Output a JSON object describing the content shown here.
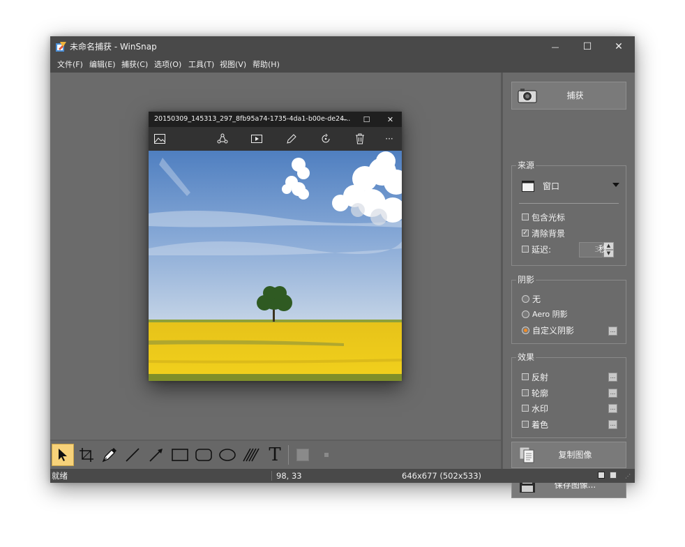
{
  "window": {
    "title": "未命名捕获 - WinSnap",
    "controls": {
      "minimize": "—",
      "maximize": "☐",
      "close": "✕"
    }
  },
  "menu": [
    "文件(F)",
    "编辑(E)",
    "捕获(C)",
    "选项(O)",
    "工具(T)",
    "视图(V)",
    "帮助(H)"
  ],
  "photos_window": {
    "title": "20150309_145313_297_8fb95a74-1735-4da1-b00e-de24...",
    "toolbar_icons": [
      "image-icon",
      "share-icon",
      "slideshow-icon",
      "edit-pencil-icon",
      "rotate-icon",
      "delete-icon",
      "more-icon"
    ],
    "more_label": "···",
    "zoom": {
      "fit": "⌑",
      "minus": "−",
      "plus": "+"
    }
  },
  "drawing_tools": [
    "pointer-tool",
    "crop-tool",
    "pen-tool",
    "line-tool",
    "arrow-tool",
    "rectangle-tool",
    "rounded-rectangle-tool",
    "ellipse-tool",
    "hatch-tool",
    "text-tool",
    "fill-color",
    "line-width"
  ],
  "status": {
    "state": "就绪",
    "coords": "98, 33",
    "size": "646x677 (502x533)"
  },
  "panel": {
    "capture_label": "捕获",
    "source": {
      "title": "来源",
      "mode": "窗口",
      "include_cursor": {
        "label": "包含光标",
        "checked": false
      },
      "clear_background": {
        "label": "清除背景",
        "checked": true
      },
      "delay": {
        "label": "延迟:",
        "value": "3",
        "unit": "秒",
        "checked": false
      }
    },
    "shadow": {
      "title": "阴影",
      "options": [
        {
          "label": "无",
          "selected": false
        },
        {
          "label": "Aero 阴影",
          "selected": false
        },
        {
          "label": "自定义阴影",
          "selected": true
        }
      ]
    },
    "effects": {
      "title": "效果",
      "items": [
        {
          "label": "反射",
          "checked": false
        },
        {
          "label": "轮廓",
          "checked": false
        },
        {
          "label": "水印",
          "checked": false
        },
        {
          "label": "着色",
          "checked": false
        }
      ]
    },
    "copy_label": "复制图像",
    "save_label": "保存图像...",
    "more_btn": "..."
  }
}
